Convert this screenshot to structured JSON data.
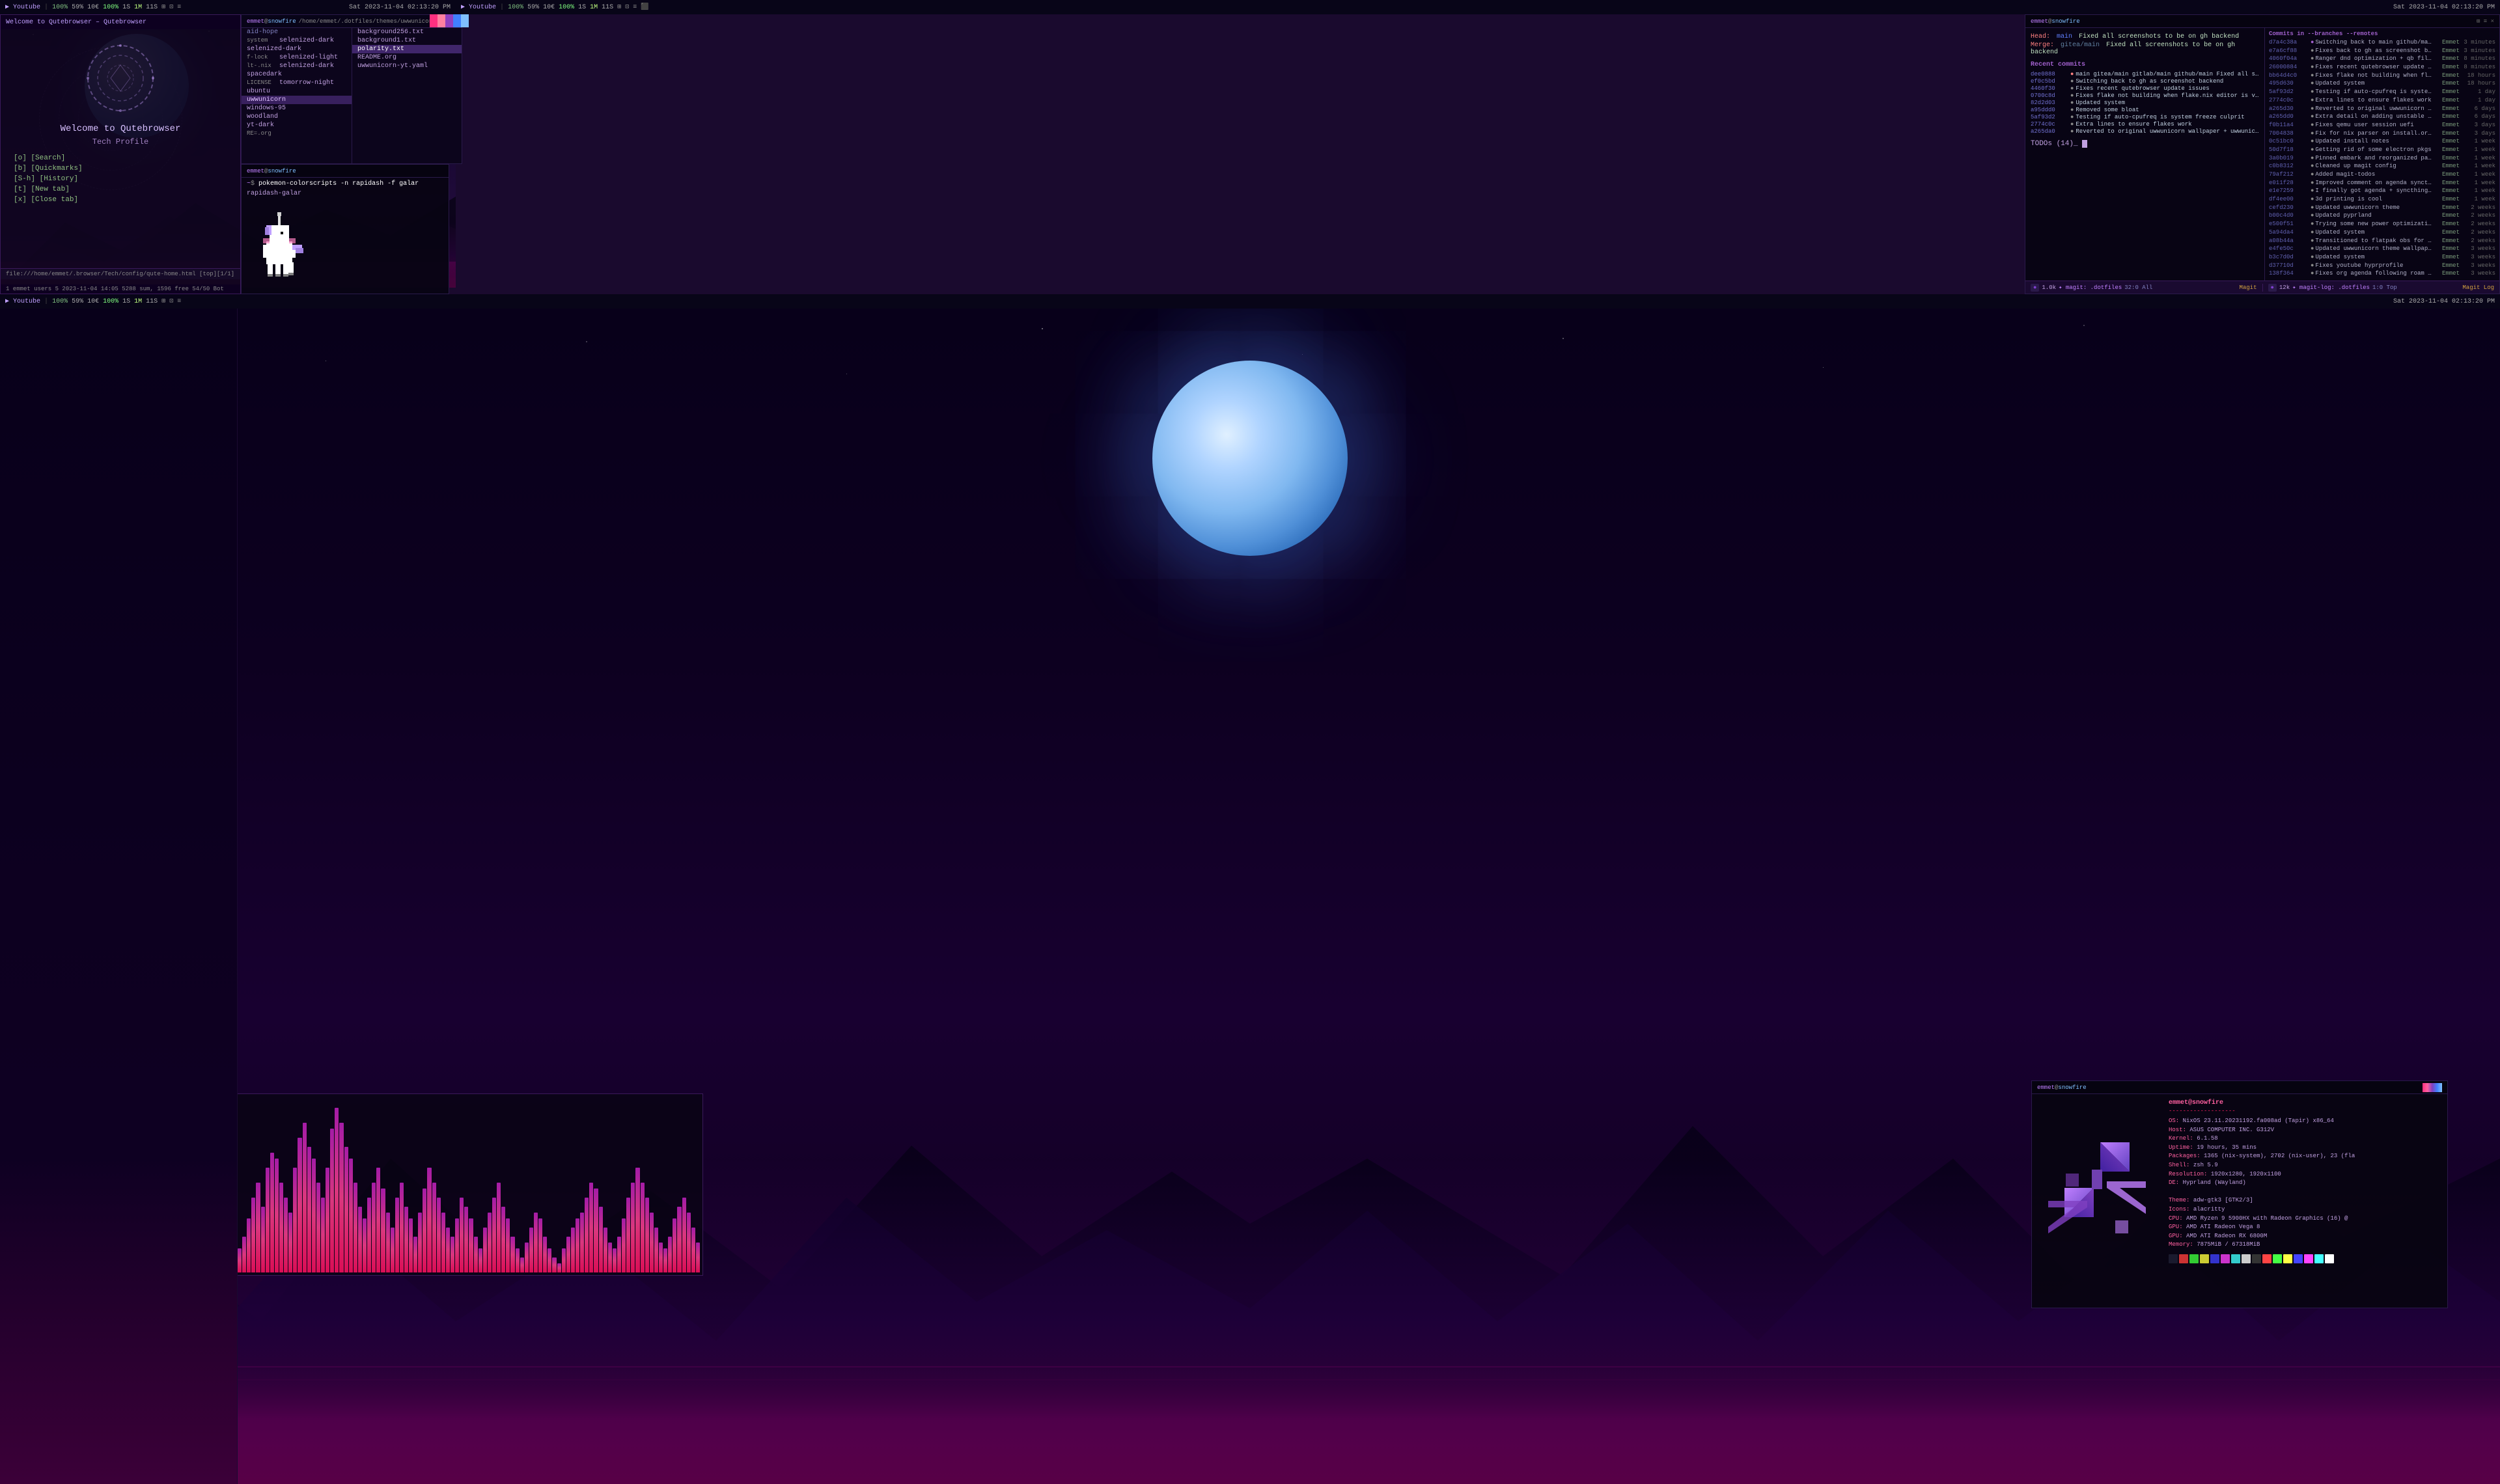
{
  "app": {
    "title": "Youtube"
  },
  "taskbar_top_left": {
    "items": [
      {
        "label": "Youtube",
        "active": true
      },
      {
        "label": "100%"
      },
      {
        "label": "59%"
      },
      {
        "label": "10€"
      },
      {
        "label": "100%"
      },
      {
        "label": "1S"
      },
      {
        "label": "1M"
      },
      {
        "label": "11S"
      }
    ],
    "time": "Sat 2023-11-04 02:13:20 PM"
  },
  "taskbar_top_right": {
    "items": [
      {
        "label": "Youtube",
        "active": true
      },
      {
        "label": "100%"
      },
      {
        "label": "59%"
      },
      {
        "label": "10€"
      },
      {
        "label": "100%"
      },
      {
        "label": "1S"
      },
      {
        "label": "1M"
      },
      {
        "label": "11S"
      }
    ],
    "time": "Sat 2023-11-04 02:13:20 PM"
  },
  "taskbar_bottom": {
    "items": [
      {
        "label": "Youtube",
        "active": true
      },
      {
        "label": "100%"
      },
      {
        "label": "59%"
      },
      {
        "label": "10€"
      },
      {
        "label": "100%"
      },
      {
        "label": "1S"
      },
      {
        "label": "1M"
      },
      {
        "label": "11S"
      }
    ],
    "time": "Sat 2023-11-04 02:13:20 PM"
  },
  "qutebrowser": {
    "title": "Welcome to Qutebrowser",
    "subtitle": "Tech Profile",
    "nav_items": [
      {
        "key": "[o]",
        "label": "[Search]"
      },
      {
        "key": "[b]",
        "label": "[Quickmarks]"
      },
      {
        "key": "[S-h]",
        "label": "[History]"
      },
      {
        "key": "[t]",
        "label": "[New tab]"
      },
      {
        "key": "[x]",
        "label": "[Close tab]"
      }
    ],
    "url": "file:///home/emmet/.browser/Tech/config/qute-home.html [top][1/1]",
    "status": "1 emmet users 5 2023-11-04 14:05 5288 sum, 1596 free  54/50  Bot"
  },
  "file_panel": {
    "header": "emmet@snowfire: /home/emmet/.dotfiles/themes/uwwunicorn-yt",
    "files": [
      {
        "name": "background256.txt",
        "size": ""
      },
      {
        "name": "background1.txt",
        "size": ""
      },
      {
        "name": "polarity.txt",
        "size": "",
        "selected": true
      },
      {
        "name": "README.org",
        "size": ""
      },
      {
        "name": "uwwunicorn-yt.yaml",
        "size": ""
      }
    ],
    "left_entries": [
      {
        "name": "aid-hope",
        "prefix": ""
      },
      {
        "name": "selenized-dark",
        "prefix": "system"
      },
      {
        "name": "selenized-dark",
        "prefix": ""
      },
      {
        "name": "selenized-light",
        "prefix": "f-lock"
      },
      {
        "name": "selenized-dark",
        "prefix": "lt-.nix"
      },
      {
        "name": "spacedark",
        "prefix": ""
      },
      {
        "name": "tomorrow-night",
        "prefix": "LICENSE"
      },
      {
        "name": "ubuntu",
        "prefix": ""
      },
      {
        "name": "uwwunicorn",
        "prefix": "",
        "highlighted": true
      },
      {
        "name": "windows-95",
        "prefix": ""
      },
      {
        "name": "woodland",
        "prefix": ""
      },
      {
        "name": "yt-dark",
        "prefix": ""
      },
      {
        "name": "RE=.org",
        "prefix": ""
      }
    ]
  },
  "pokemon_panel": {
    "header": "emmet@snowfire: ~",
    "command": "pokemon-colorscripts -n rapidash -f galar",
    "name": "rapidash-galar"
  },
  "git_panel": {
    "header": "emmet@snowfire: ~",
    "merge": {
      "head_label": "Head:",
      "head_branch": "main",
      "head_msg": "Fixed all screenshots to be on gh backend",
      "merge_label": "Merge:",
      "merge_ref": "gitea/main",
      "merge_msg": "Fixed all screenshots to be on gh backend"
    },
    "recent_commits_title": "Recent commits",
    "commits": [
      {
        "hash": "dee0888",
        "msg": "main gitea/main gitlab/main github/main Fixed all screenshots to be on gh backend"
      },
      {
        "hash": "ef0c5bd",
        "msg": "Switching back to gh as screenshot backend"
      },
      {
        "hash": "4460f30",
        "msg": "Fixes recent qutebrowser update issues"
      },
      {
        "hash": "0700c8d",
        "msg": "Fixes flake not building when flake.nix editor is vim, nvim or nano"
      },
      {
        "hash": "82d2d03",
        "msg": "Updated system"
      },
      {
        "hash": "a95ddd0",
        "msg": "Removed some bloat"
      },
      {
        "hash": "5af93d2",
        "msg": "Testing if auto-cpufreq is system freeze culprit"
      },
      {
        "hash": "2774c0c",
        "msg": "Extra lines to ensure flakes work"
      },
      {
        "hash": "a265da0",
        "msg": "Reverted to original uwwunicorn wallpaper + uwwunicorn yt wallpaper vari..."
      }
    ],
    "todos": "TODOs (14)_",
    "log_title": "Commits in --branches --remotes",
    "log_entries": [
      {
        "hash": "d7a4c38a",
        "msg": "Switching back to main github/main github/ma Emmet",
        "time": "3 minutes"
      },
      {
        "hash": "e7a6cf88",
        "msg": "Fixes back to gh as screenshot backend Emmet",
        "time": "3 minutes"
      },
      {
        "hash": "4060f04a",
        "msg": "Ranger dnd optimization + qb filepick Emmet",
        "time": "8 minutes"
      },
      {
        "hash": "26000884",
        "msg": "Fixes recent qutebrowser update issues Emmet",
        "time": "8 minutes"
      },
      {
        "hash": "bb64d4c0",
        "msg": "Fixes flake not building when flake.ni Emmet",
        "time": "18 hours"
      },
      {
        "hash": "495d630",
        "msg": "Updated system Emmet",
        "time": "18 hours"
      },
      {
        "hash": "5af93d2",
        "msg": "Testing if auto-cpufreq is system fre Emmet",
        "time": "1 day"
      },
      {
        "hash": "2774c0c",
        "msg": "Extra lines to ensure flakes work Emmet",
        "time": "1 day"
      },
      {
        "hash": "a265d30",
        "msg": "Reverted to original uwwunicorn wallpa Emmet",
        "time": "6 days"
      },
      {
        "hash": "a265dd0",
        "msg": "Extra detail on adding unstable chann Emmet",
        "time": "6 days"
      },
      {
        "hash": "f0b11a4",
        "msg": "Fixes qemu user session uefi Emmet",
        "time": "3 days"
      },
      {
        "hash": "7004838",
        "msg": "Fix for nix parser on install.org? Emmet",
        "time": "3 days"
      },
      {
        "hash": "0c51bc0",
        "msg": "Updated install notes Emmet",
        "time": "1 week"
      },
      {
        "hash": "50d7f18",
        "msg": "Getting rid of some electron pkgs Emmet",
        "time": "1 week"
      },
      {
        "hash": "3a0b019",
        "msg": "Pinned embark and reorganized package Emmet",
        "time": "1 week"
      },
      {
        "hash": "c0b8312",
        "msg": "Cleaned up magit config Emmet",
        "time": "1 week"
      },
      {
        "hash": "79af212",
        "msg": "Added magit-todos Emmet",
        "time": "1 week"
      },
      {
        "hash": "e011f28",
        "msg": "Improved comment on agenda syncthing Emmet",
        "time": "1 week"
      },
      {
        "hash": "e1e7259",
        "msg": "I finally got agenda + syncthing to b Emmet",
        "time": "1 week"
      },
      {
        "hash": "df4ee00",
        "msg": "3d printing is cool Emmet",
        "time": "1 week"
      },
      {
        "hash": "cefd230",
        "msg": "Updated uwwunicorn theme Emmet",
        "time": "2 weeks"
      },
      {
        "hash": "b00c4d0",
        "msg": "Updated pyprland Emmet",
        "time": "2 weeks"
      },
      {
        "hash": "e500f51",
        "msg": "Trying some new power optimizations! Emmet",
        "time": "2 weeks"
      },
      {
        "hash": "5a94da4",
        "msg": "Updated system Emmet",
        "time": "2 weeks"
      },
      {
        "hash": "a08b44a",
        "msg": "Transitioned to flatpak obs for now Emmet",
        "time": "2 weeks"
      },
      {
        "hash": "e4fe50c",
        "msg": "Updated uwwunicorn theme wallpaper for Emmet",
        "time": "3 weeks"
      },
      {
        "hash": "b3c7d0d",
        "msg": "Updated system Emmet",
        "time": "3 weeks"
      },
      {
        "hash": "d37710d",
        "msg": "Fixes youtube hyprprofile Emmet",
        "time": "3 weeks"
      },
      {
        "hash": "138f364",
        "msg": "Fixes org agenda following roam conta Emmet",
        "time": "3 weeks"
      }
    ],
    "status_left": "1.0k  magit: .dotfiles  32:0 All",
    "status_left_mode": "Magit",
    "status_right": "12k  magit-log: .dotfiles  1:0 Top",
    "status_right_mode": "Magit Log"
  },
  "neofetch": {
    "user": "emmet@snowfire",
    "separator": "-------------------",
    "lines": [
      {
        "key": "OS:",
        "val": "NixOS 23.11.20231192.fa008ad (Tapir) x86_64"
      },
      {
        "key": "Host:",
        "val": "ASUS COMPUTER INC. G312V"
      },
      {
        "key": "Kernel:",
        "val": "6.1.58"
      },
      {
        "key": "Uptime:",
        "val": "19 hours, 35 mins"
      },
      {
        "key": "Packages:",
        "val": "1365 (nix-system), 2702 (nix-user), 23 (fla"
      },
      {
        "key": "Shell:",
        "val": "zsh 5.9"
      },
      {
        "key": "Resolution:",
        "val": "1920x1280, 1920x1100"
      },
      {
        "key": "DE:",
        "val": "Hyprland (Wayland)"
      },
      {
        "key": "",
        "val": ""
      },
      {
        "key": "Theme:",
        "val": "adw-gtk3 [GTK2/3]"
      },
      {
        "key": "Icons:",
        "val": "alacritty"
      },
      {
        "key": "CPU:",
        "val": "AMD Ryzen 9 5900HX with Radeon Graphics (16) @"
      },
      {
        "key": "GPU:",
        "val": "AMD ATI Radeon Vega 8"
      },
      {
        "key": "GPU2:",
        "val": "AMD ATI Radeon RX 6800M"
      },
      {
        "key": "Memory:",
        "val": "7875MiB / 67318MiB"
      }
    ],
    "colors": [
      "#1a1a2e",
      "#cc3333",
      "#33cc33",
      "#cccc33",
      "#3333cc",
      "#cc33cc",
      "#33cccc",
      "#cccccc",
      "#333333",
      "#ff4444",
      "#44ff44",
      "#ffff44",
      "#4444ff",
      "#ff44ff",
      "#44ffff",
      "#ffffff"
    ]
  },
  "visualizer": {
    "bars": [
      8,
      12,
      18,
      25,
      30,
      22,
      35,
      40,
      38,
      30,
      25,
      20,
      35,
      45,
      50,
      42,
      38,
      30,
      25,
      35,
      48,
      55,
      50,
      42,
      38,
      30,
      22,
      18,
      25,
      30,
      35,
      28,
      20,
      15,
      25,
      30,
      22,
      18,
      12,
      20,
      28,
      35,
      30,
      25,
      20,
      15,
      12,
      18,
      25,
      22,
      18,
      12,
      8,
      15,
      20,
      25,
      30,
      22,
      18,
      12,
      8,
      5,
      10,
      15,
      20,
      18,
      12,
      8,
      5,
      3,
      8,
      12,
      15,
      18,
      20,
      25,
      30,
      28,
      22,
      15,
      10,
      8,
      12,
      18,
      25,
      30,
      35,
      30,
      25,
      20,
      15,
      10,
      8,
      12,
      18,
      22,
      25,
      20,
      15,
      10
    ]
  },
  "color_palette": {
    "colors": [
      "#ff3080",
      "#ff80c0",
      "#8040c0",
      "#4080ff",
      "#80c0ff"
    ]
  }
}
